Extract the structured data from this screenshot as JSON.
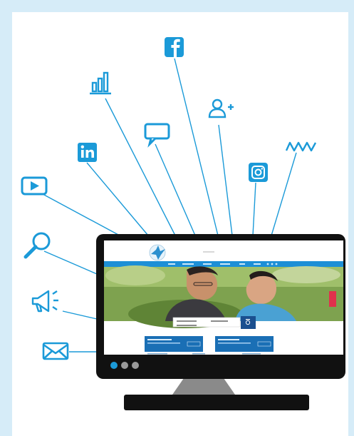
{
  "colors": {
    "page_border": "#d6ecf8",
    "background": "#ffffff",
    "icon_blue": "#1b9ad8",
    "monitor_body": "#111111",
    "monitor_stand": "#8a8a8a",
    "site_nav": "#1d8fd6",
    "site_panel": "#1a6fb5"
  },
  "icons": [
    "facebook-icon",
    "bar-chart-icon",
    "add-user-icon",
    "chat-bubble-icon",
    "linkedin-icon",
    "activity-line-icon",
    "instagram-icon",
    "play-button-icon",
    "search-icon",
    "megaphone-icon",
    "mail-icon"
  ],
  "monitor": {
    "carousel_dots": 3,
    "active_dot": 1
  }
}
